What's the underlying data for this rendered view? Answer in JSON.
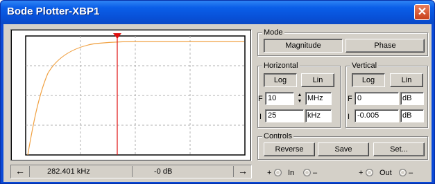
{
  "window": {
    "title": "Bode Plotter-XBP1",
    "close_icon": "✕"
  },
  "plot": {
    "grid_color": "#b0b0b0",
    "curve_color": "#f0a040",
    "cursor_color": "#e01010"
  },
  "status": {
    "left_arrow": "←",
    "right_arrow": "→",
    "x_readout": "282.401 kHz",
    "y_readout": "-0 dB"
  },
  "mode": {
    "label": "Mode",
    "magnitude": "Magnitude",
    "phase": "Phase"
  },
  "horizontal": {
    "label": "Horizontal",
    "log": "Log",
    "lin": "Lin",
    "f_label": "F",
    "f_value": "10",
    "f_unit": "MHz",
    "i_label": "I",
    "i_value": "25",
    "i_unit": "kHz"
  },
  "vertical": {
    "label": "Vertical",
    "log": "Log",
    "lin": "Lin",
    "f_label": "F",
    "f_value": "0",
    "f_unit": "dB",
    "i_label": "I",
    "i_value": "-0.005",
    "i_unit": "dB"
  },
  "controls": {
    "label": "Controls",
    "reverse": "Reverse",
    "save": "Save",
    "set": "Set..."
  },
  "terminals": {
    "in_plus": "+",
    "in_label": "In",
    "in_minus": "–",
    "out_plus": "+",
    "out_label": "Out",
    "out_minus": "–"
  }
}
